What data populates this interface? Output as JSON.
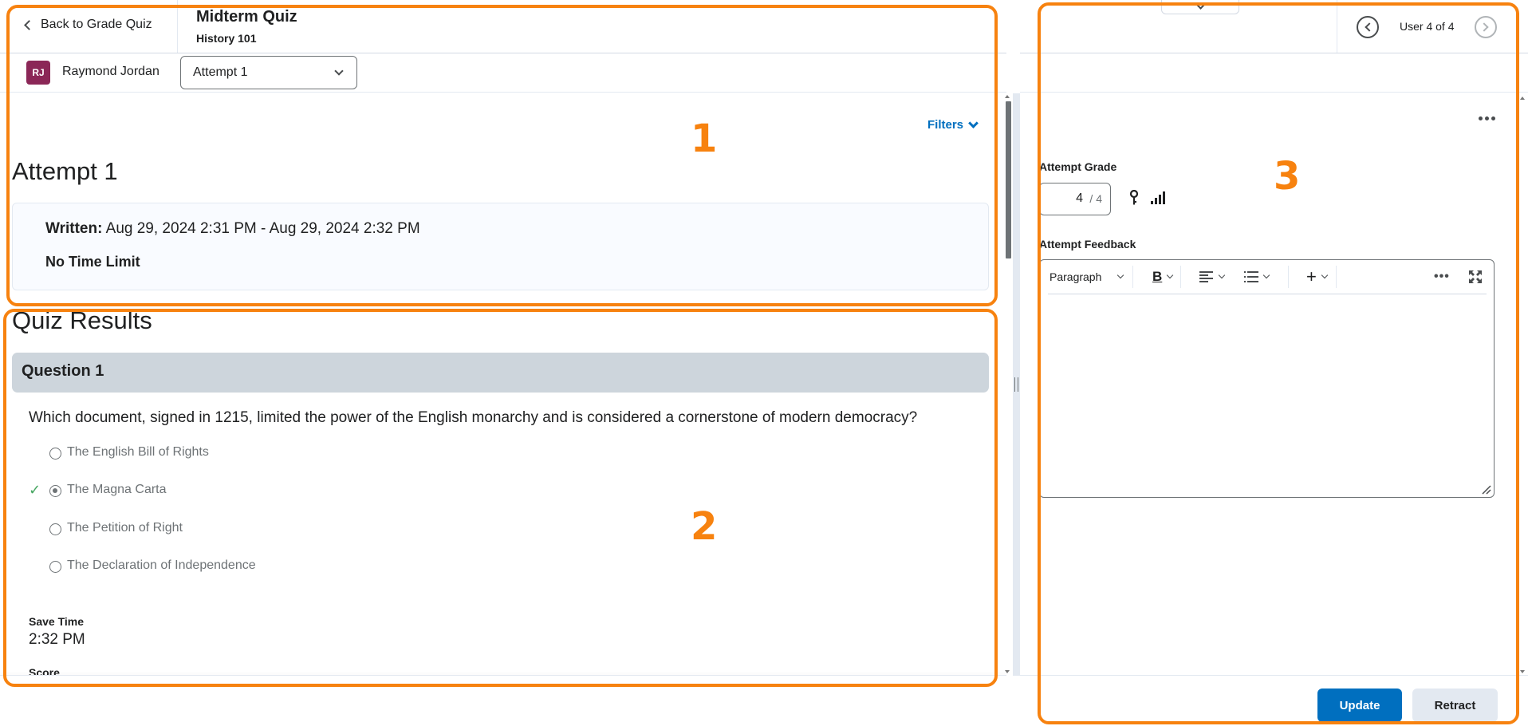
{
  "header": {
    "back_label": "Back to Grade Quiz",
    "quiz_title": "Midterm Quiz",
    "course": "History 101"
  },
  "user": {
    "initials": "RJ",
    "name": "Raymond Jordan",
    "avatar_color": "#8b2757"
  },
  "attempt_select": {
    "selected": "Attempt 1"
  },
  "filters_label": "Filters",
  "attempt": {
    "heading": "Attempt 1",
    "written_label": "Written:",
    "written_value": "Aug 29, 2024 2:31 PM - Aug 29, 2024 2:32 PM",
    "time_limit": "No Time Limit"
  },
  "results": {
    "heading": "Quiz Results",
    "questions": [
      {
        "title": "Question 1",
        "text": "Which document, signed in 1215, limited the power of the English monarchy and is considered a cornerstone of modern democracy?",
        "options": [
          {
            "label": "The English Bill of Rights",
            "selected": false,
            "correct": false
          },
          {
            "label": "The Magna Carta",
            "selected": true,
            "correct": true
          },
          {
            "label": "The Petition of Right",
            "selected": false,
            "correct": false
          },
          {
            "label": "The Declaration of Independence",
            "selected": false,
            "correct": false
          }
        ],
        "save_time_label": "Save Time",
        "save_time_value": "2:32 PM",
        "score_label": "Score"
      }
    ]
  },
  "nav": {
    "user_count": "User 4 of 4"
  },
  "grading": {
    "grade_label": "Attempt Grade",
    "grade_value": "4",
    "grade_max": "/ 4",
    "feedback_label": "Attempt Feedback",
    "editor": {
      "format_select": "Paragraph",
      "bold_label": "B",
      "content": ""
    },
    "update_label": "Update",
    "retract_label": "Retract"
  },
  "annotations": [
    {
      "label": "1"
    },
    {
      "label": "2"
    },
    {
      "label": "3"
    }
  ],
  "colors": {
    "accent": "#006fbf",
    "correct": "#46a661",
    "annotation": "#f7820f",
    "question_header_bg": "#cdd5dc"
  }
}
